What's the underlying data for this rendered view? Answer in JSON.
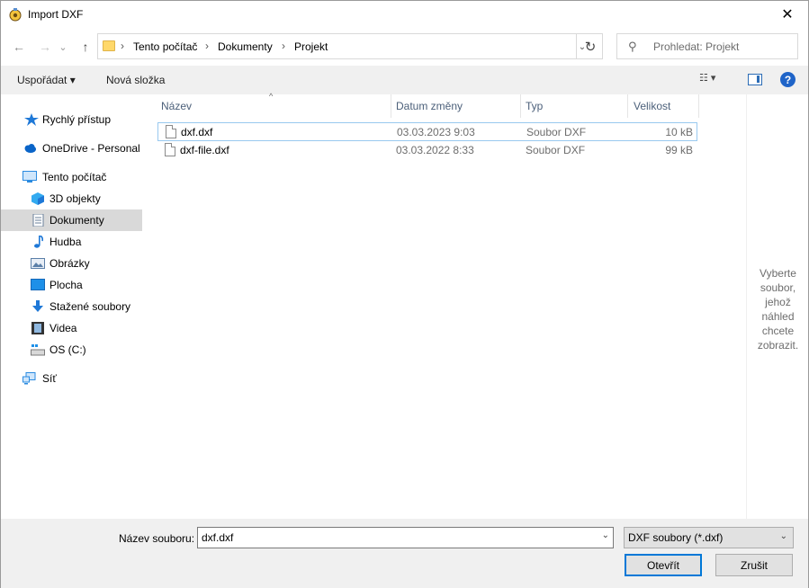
{
  "window": {
    "title": "Import DXF",
    "close_glyph": "✕"
  },
  "nav": {
    "back_glyph": "←",
    "forward_glyph": "→",
    "recent_glyph": "⌄",
    "up_glyph": "↑"
  },
  "address": {
    "crumbs": [
      "Tento počítač",
      "Dokumenty",
      "Projekt"
    ],
    "separator": "›",
    "dropdown_glyph": "⌄",
    "refresh_glyph": "↻"
  },
  "search": {
    "placeholder": "Prohledat: Projekt",
    "icon_glyph": "⚲"
  },
  "toolbar": {
    "organize_label": "Uspořádat ▾",
    "new_folder_label": "Nová složka",
    "view_glyph": "☷ ▾",
    "help_glyph": "?"
  },
  "sidebar": {
    "items": [
      {
        "label": "Rychlý přístup",
        "icon": "star-icon",
        "color": "#1e78d7"
      },
      {
        "label": "OneDrive - Personal",
        "icon": "cloud-icon",
        "color": "#0a64c8"
      },
      {
        "label": "Tento počítač",
        "icon": "computer-icon",
        "color": "#2b8be0"
      },
      {
        "label": "3D objekty",
        "icon": "cube-icon",
        "color": "#33aaf0"
      },
      {
        "label": "Dokumenty",
        "icon": "document-icon",
        "color": "#6a7f99"
      },
      {
        "label": "Hudba",
        "icon": "music-icon",
        "color": "#1e78d7"
      },
      {
        "label": "Obrázky",
        "icon": "picture-icon",
        "color": "#5b7fa8"
      },
      {
        "label": "Plocha",
        "icon": "desktop-icon",
        "color": "#1e90e8"
      },
      {
        "label": "Stažené soubory",
        "icon": "download-icon",
        "color": "#1e78d7"
      },
      {
        "label": "Videa",
        "icon": "film-icon",
        "color": "#333333"
      },
      {
        "label": "OS (C:)",
        "icon": "drive-icon",
        "color": "#7a7a7a"
      },
      {
        "label": "Síť",
        "icon": "network-icon",
        "color": "#2b8be0"
      }
    ],
    "selected_label": "Dokumenty"
  },
  "filelist": {
    "columns": [
      "Název",
      "Datum změny",
      "Typ",
      "Velikost"
    ],
    "sort_glyph": "^",
    "rows": [
      {
        "name": "dxf.dxf",
        "date": "03.03.2023 9:03",
        "type": "Soubor DXF",
        "size": "10 kB"
      },
      {
        "name": "dxf-file.dxf",
        "date": "03.03.2022 8:33",
        "type": "Soubor DXF",
        "size": "99 kB"
      }
    ]
  },
  "preview": {
    "lines": [
      "Vyberte",
      "soubor,",
      "jehož",
      "náhled",
      "chcete",
      "zobrazit."
    ]
  },
  "bottom": {
    "filename_label": "Název souboru:",
    "filename_value": "dxf.dxf",
    "dropdown_glyph": "⌄",
    "filter_value": "DXF soubory (*.dxf)",
    "open_label": "Otevřít",
    "cancel_label": "Zrušit"
  },
  "colors": {
    "accent": "#0078d7",
    "selection": "#d9d9d9",
    "focus_border": "#99c9ef",
    "header_text": "#4c607a"
  }
}
